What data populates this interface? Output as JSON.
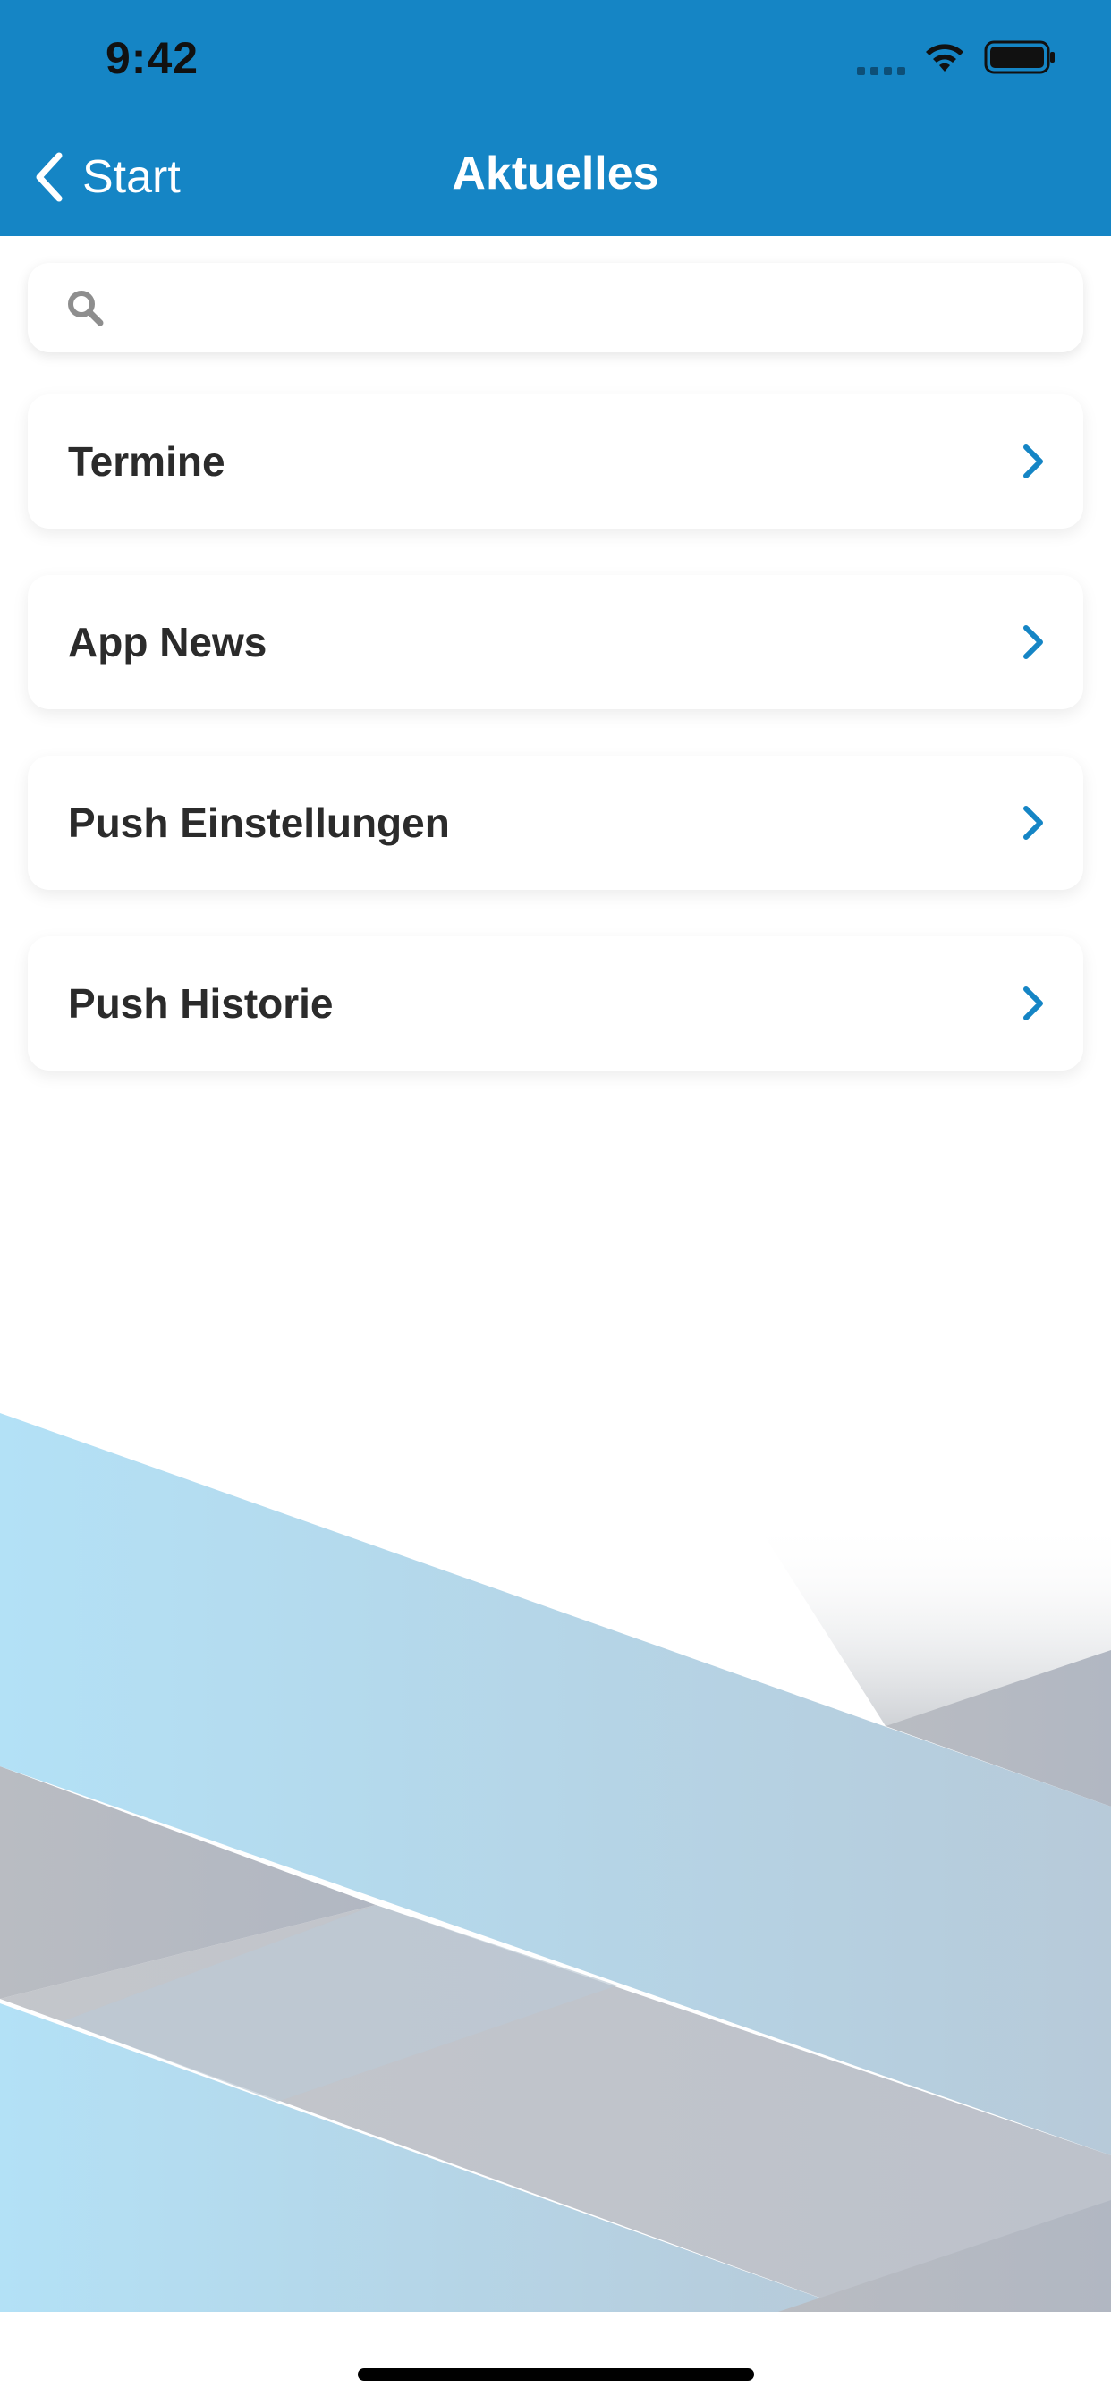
{
  "status_bar": {
    "time": "9:42"
  },
  "nav": {
    "back_label": "Start",
    "title": "Aktuelles"
  },
  "search": {
    "placeholder": ""
  },
  "menu": {
    "items": [
      {
        "label": "Termine"
      },
      {
        "label": "App News"
      },
      {
        "label": "Push Einstellungen"
      },
      {
        "label": "Push Historie"
      }
    ]
  },
  "colors": {
    "header": "#1585c5",
    "accent": "#1585c5",
    "text": "#2b2b2b",
    "background_stripe_light": "#b3e0f5",
    "background_stripe_gray": "#b4b7bd"
  }
}
